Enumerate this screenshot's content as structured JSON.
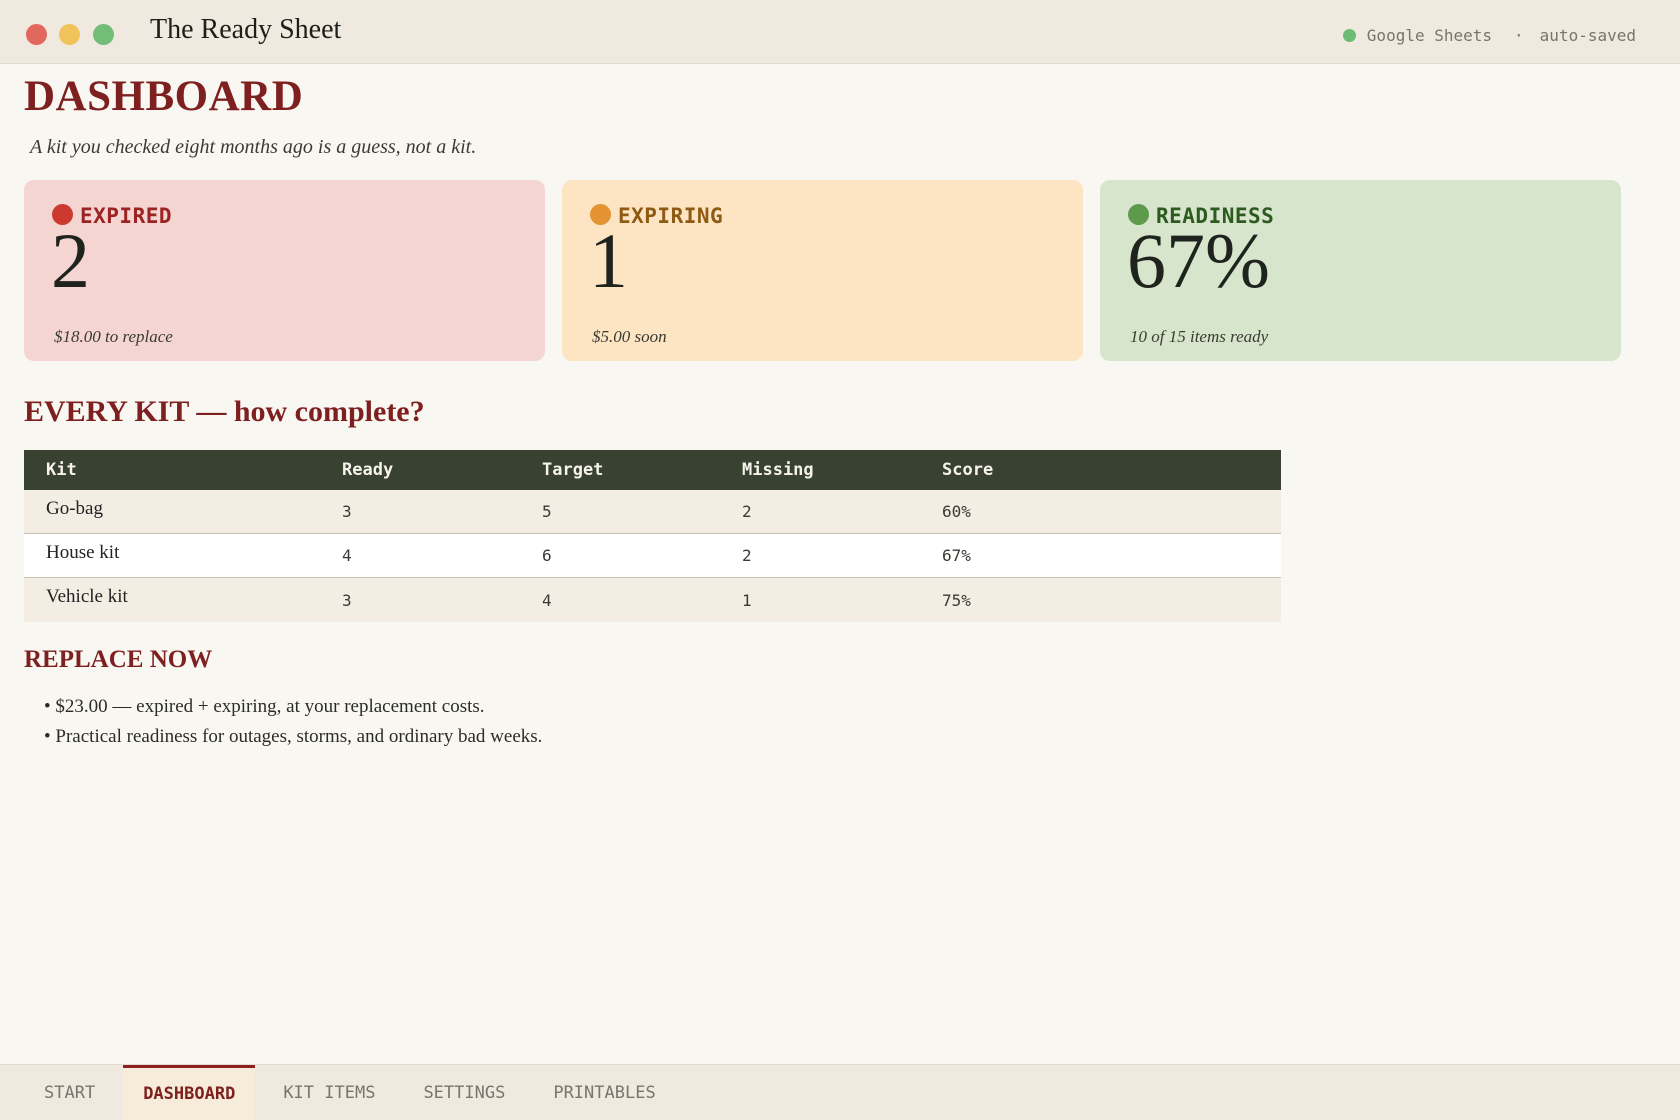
{
  "window": {
    "title": "The Ready Sheet",
    "status_app": "Google Sheets",
    "status_sep": "·",
    "status_state": "auto-saved"
  },
  "page": {
    "title": "DASHBOARD",
    "tagline": "A kit you checked eight months ago is a guess, not a kit."
  },
  "cards": [
    {
      "label": "EXPIRED",
      "value": "2",
      "note": "$18.00 to replace",
      "color": "#cc3a2f"
    },
    {
      "label": "EXPIRING",
      "value": "1",
      "note": "$5.00 soon",
      "color": "#e39332"
    },
    {
      "label": "READINESS",
      "value": "67%",
      "note": "10 of 15 items ready",
      "color": "#5d9a4b"
    }
  ],
  "kits": {
    "title": "EVERY KIT — how complete?",
    "headers": [
      "Kit",
      "Ready",
      "Target",
      "Missing",
      "Score"
    ],
    "rows": [
      [
        "Go-bag",
        "3",
        "5",
        "2",
        "60%"
      ],
      [
        "House kit",
        "4",
        "6",
        "2",
        "67%"
      ],
      [
        "Vehicle kit",
        "3",
        "4",
        "1",
        "75%"
      ]
    ]
  },
  "replace": {
    "title": "REPLACE NOW",
    "items": [
      "$23.00 — expired + expiring, at your replacement costs.",
      "Practical readiness for outages, storms, and ordinary bad weeks."
    ]
  },
  "tabs": [
    {
      "label": "START",
      "active": false
    },
    {
      "label": "DASHBOARD",
      "active": true
    },
    {
      "label": "KIT ITEMS",
      "active": false
    },
    {
      "label": "SETTINGS",
      "active": false
    },
    {
      "label": "PRINTABLES",
      "active": false
    }
  ]
}
